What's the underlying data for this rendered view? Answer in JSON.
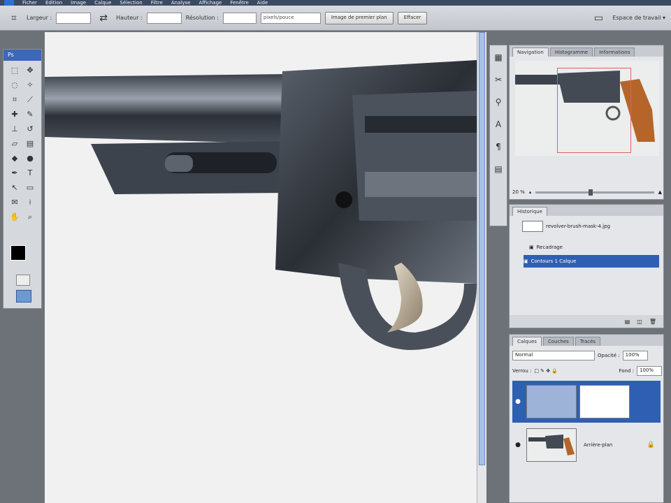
{
  "menubar": {
    "items": [
      "Ficher",
      "Edition",
      "Image",
      "Calque",
      "Sélection",
      "Filtre",
      "Analyse",
      "Affichage",
      "Fenêtre",
      "Aide"
    ]
  },
  "options": {
    "largeur_label": "Largeur :",
    "hauteur_label": "Hauteur :",
    "resolution_label": "Résolution :",
    "unit_value": "pixels/pouce",
    "image_btn": "Image de premier plan",
    "effacer_btn": "Effacer",
    "workspace": "Espace de travail ▾"
  },
  "tools": {
    "title": "Ps"
  },
  "navigator": {
    "tabs": [
      "Navigation",
      "Histogramme",
      "Informations"
    ],
    "zoom": "20 %"
  },
  "history": {
    "tabs": [
      "Historique"
    ],
    "rows": [
      {
        "label": "revolver-brush-mask-4.jpg"
      },
      {
        "label": "Recadrage"
      },
      {
        "label": "Contours 1 Calque"
      }
    ]
  },
  "layers": {
    "tabs": [
      "Calques",
      "Couches",
      "Tracés"
    ],
    "blend_mode": "Normal",
    "opacity_label": "Opacité :",
    "opacity_value": "100%",
    "lock_label": "Verrou :",
    "fill_label": "Fond :",
    "fill_value": "100%",
    "rows": [
      {
        "name": ""
      },
      {
        "name": "Arrière-plan"
      }
    ]
  },
  "colors": {
    "accent": "#2f5fb3",
    "foreground": "#000000",
    "background": "#ffffff"
  }
}
